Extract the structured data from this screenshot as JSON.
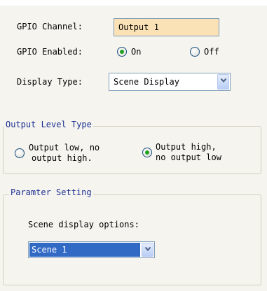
{
  "gpio_channel": {
    "label": "GPIO Channel:",
    "value": "Output 1"
  },
  "gpio_enabled": {
    "label": "GPIO Enabled:",
    "on_label": "On",
    "off_label": "Off",
    "selected": "On"
  },
  "display_type": {
    "label": "Display Type:",
    "selected": "Scene Display"
  },
  "output_level": {
    "title": "Output Level Type",
    "option_low_line1": "Output low, no",
    "option_low_line2": "output high.",
    "option_high_line1": "Output high,",
    "option_high_line2": "no output low",
    "selected": "high"
  },
  "parameter_setting": {
    "title": "Paramter Setting",
    "scene_label": "Scene display options:",
    "scene_selected": "Scene 1"
  },
  "colors": {
    "input_bg": "#fbe2b6",
    "group_title": "#1c2f8f",
    "selection": "#316ac5",
    "radio_dot": "#21a121"
  }
}
